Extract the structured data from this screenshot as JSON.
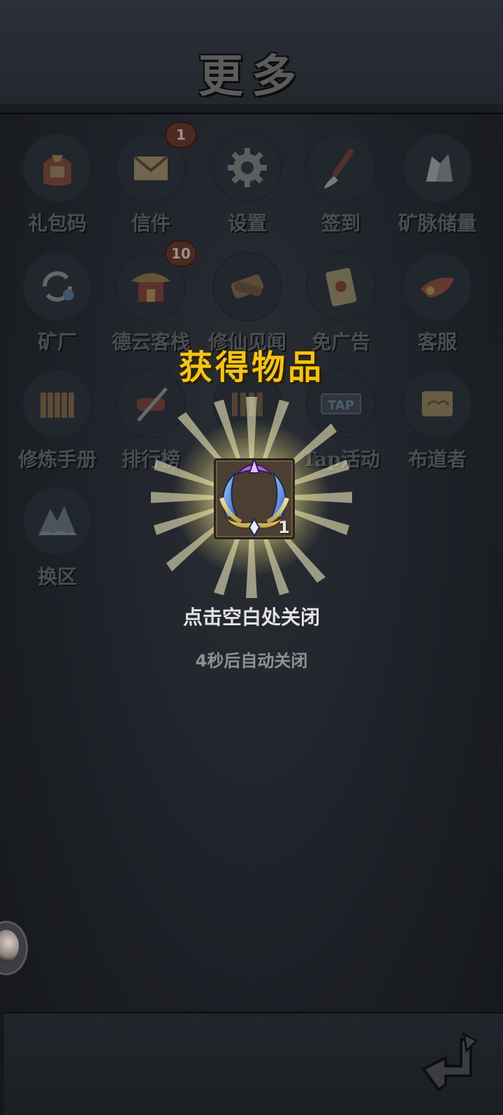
{
  "header": {
    "title": "更多"
  },
  "grid": {
    "items": [
      {
        "label": "礼包码",
        "icon": "gift-bag-icon"
      },
      {
        "label": "信件",
        "icon": "envelope-icon",
        "badge": "1"
      },
      {
        "label": "设置",
        "icon": "gear-icon"
      },
      {
        "label": "签到",
        "icon": "brush-icon"
      },
      {
        "label": "矿脉储量",
        "icon": "ore-icon"
      },
      {
        "label": "矿厂",
        "icon": "refresh-ore-icon"
      },
      {
        "label": "德云客栈",
        "icon": "inn-icon",
        "badge": "10"
      },
      {
        "label": "修仙见闻",
        "icon": "scroll-bundle-icon"
      },
      {
        "label": "免广告",
        "icon": "ticket-icon"
      },
      {
        "label": "客服",
        "icon": "horn-icon"
      },
      {
        "label": "修炼手册",
        "icon": "bamboo-scroll-icon"
      },
      {
        "label": "排行榜",
        "icon": "sword-scroll-icon"
      },
      {
        "label": "",
        "icon": "bamboo-scroll-icon"
      },
      {
        "label": "Tap活动",
        "icon": "tap-icon",
        "icon_text": "TAP"
      },
      {
        "label": "布道者",
        "icon": "cloud-scroll-icon"
      },
      {
        "label": "换区",
        "icon": "mountain-icon"
      }
    ]
  },
  "popup": {
    "title": "获得物品",
    "item": {
      "icon": "crown-wreath-icon",
      "count": "1"
    },
    "close_hint": "点击空白处关闭",
    "auto_close_hint": "4秒后自动关闭"
  },
  "colors": {
    "popup_title": "#f2c318",
    "badge": "#4a2a22",
    "background": "#1d2026"
  },
  "side": {
    "avatar": "character-avatar"
  },
  "bottom": {
    "back": "return-arrow-icon"
  }
}
